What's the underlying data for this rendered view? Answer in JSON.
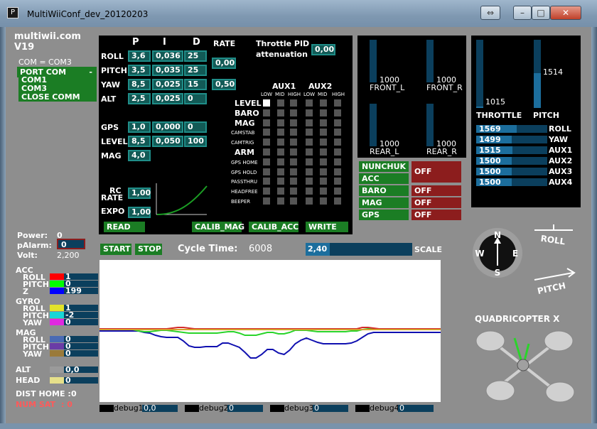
{
  "window": {
    "title": "MultiWiiConf_dev_20120203",
    "icon_text": "P"
  },
  "app": {
    "name": "multiwii.com",
    "version": "V19"
  },
  "com": {
    "current": "COM = COM3",
    "port_label": "PORT COM",
    "port_dash": "-",
    "ports": [
      "COM1",
      "COM3"
    ],
    "close_label": "CLOSE COMM"
  },
  "pid": {
    "headers": {
      "p": "P",
      "i": "I",
      "d": "D",
      "rate": "RATE"
    },
    "rows": [
      {
        "name": "ROLL",
        "p": "3,6",
        "i": "0,036",
        "d": "25"
      },
      {
        "name": "PITCH",
        "p": "3,5",
        "i": "0,035",
        "d": "25"
      },
      {
        "name": "YAW",
        "p": "8,5",
        "i": "0,025",
        "d": "15"
      },
      {
        "name": "ALT",
        "p": "2,5",
        "i": "0,025",
        "d": "0"
      },
      {
        "name": "GPS",
        "p": "1,0",
        "i": "0,000",
        "d": "0"
      },
      {
        "name": "LEVEL",
        "p": "8,5",
        "i": "0,050",
        "d": "100"
      },
      {
        "name": "MAG",
        "p": "4,0",
        "i": "",
        "d": ""
      }
    ],
    "rate_roll_pitch": "0,00",
    "rate_yaw": "0,50",
    "throttle_pid_label_1": "Throttle PID",
    "throttle_pid_label_2": "attenuation",
    "throttle_pid_value": "0,00",
    "rc_rate_label_1": "RC",
    "rc_rate_label_2": "RATE",
    "rc_rate_value": "1,00",
    "expo_label": "EXPO",
    "expo_value": "1,00"
  },
  "aux": {
    "aux1_label": "AUX1",
    "aux2_label": "AUX2",
    "subheads": [
      "LOW",
      "MID",
      "HIGH",
      "LOW",
      "MID",
      "HIGH"
    ],
    "boxes": [
      {
        "name": "LEVEL",
        "small": false,
        "on": [
          true,
          false,
          false,
          false,
          false,
          false
        ]
      },
      {
        "name": "BARO",
        "small": false,
        "on": [
          false,
          false,
          false,
          false,
          false,
          false
        ]
      },
      {
        "name": "MAG",
        "small": false,
        "on": [
          false,
          false,
          false,
          false,
          false,
          false
        ]
      },
      {
        "name": "CAMSTAB",
        "small": true,
        "on": [
          false,
          false,
          false,
          false,
          false,
          false
        ]
      },
      {
        "name": "CAMTRIG",
        "small": true,
        "on": [
          false,
          false,
          false,
          false,
          false,
          false
        ]
      },
      {
        "name": "ARM",
        "small": false,
        "on": [
          false,
          false,
          false,
          false,
          false,
          false
        ]
      },
      {
        "name": "GPS HOME",
        "small": true,
        "on": [
          false,
          false,
          false,
          false,
          false,
          false
        ]
      },
      {
        "name": "GPS HOLD",
        "small": true,
        "on": [
          false,
          false,
          false,
          false,
          false,
          false
        ]
      },
      {
        "name": "PASSTHRU",
        "small": true,
        "on": [
          false,
          false,
          false,
          false,
          false,
          false
        ]
      },
      {
        "name": "HEADFREE",
        "small": true,
        "on": [
          false,
          false,
          false,
          false,
          false,
          false
        ]
      },
      {
        "name": "BEEPER",
        "small": true,
        "on": [
          false,
          false,
          false,
          false,
          false,
          false
        ]
      }
    ]
  },
  "buttons": {
    "read": "READ",
    "calib_mag": "CALIB_MAG",
    "calib_acc": "CALIB_ACC",
    "write": "WRITE",
    "start": "START",
    "stop": "STOP"
  },
  "motors": [
    {
      "label": "FRONT_L",
      "value": "1000",
      "level": 0.0
    },
    {
      "label": "FRONT_R",
      "value": "1000",
      "level": 0.0
    },
    {
      "label": "REAR_L",
      "value": "1000",
      "level": 0.0
    },
    {
      "label": "REAR_R",
      "value": "1000",
      "level": 0.0
    }
  ],
  "sensors_status": [
    {
      "name": "NUNCHUK",
      "state": "OFF"
    },
    {
      "name": "ACC",
      "state": "OFF"
    },
    {
      "name": "BARO",
      "state": "OFF"
    },
    {
      "name": "MAG",
      "state": "OFF"
    },
    {
      "name": "GPS",
      "state": "OFF"
    }
  ],
  "rc": {
    "throttle": {
      "label": "THROTTLE",
      "value": "1015",
      "level": 0.02
    },
    "pitch": {
      "label": "PITCH",
      "value": "1514",
      "level": 0.51
    },
    "channels": [
      {
        "name": "ROLL",
        "value": "1569",
        "level": 0.57
      },
      {
        "name": "YAW",
        "value": "1499",
        "level": 0.5
      },
      {
        "name": "AUX1",
        "value": "1515",
        "level": 0.51
      },
      {
        "name": "AUX2",
        "value": "1500",
        "level": 0.5
      },
      {
        "name": "AUX3",
        "value": "1500",
        "level": 0.5
      },
      {
        "name": "AUX4",
        "value": "1500",
        "level": 0.5
      }
    ]
  },
  "status": {
    "power_label": "Power:",
    "power_value": "0",
    "palarm_label": "pAlarm:",
    "palarm_value": "0",
    "volt_label": "Volt:",
    "volt_value": "2,200",
    "cycle_label": "Cycle Time:",
    "cycle_value": "6008",
    "scale_value": "2,40",
    "scale_label": "SCALE",
    "dist_home_label": "DIST HOME :",
    "dist_home_value": "0",
    "num_sat_label": "NUM SAT",
    "num_sat_value": ":   0"
  },
  "sensor_values": {
    "acc": {
      "label": "ACC",
      "rows": [
        {
          "axis": "ROLL",
          "value": "1",
          "color": "#ff0000"
        },
        {
          "axis": "PITCH",
          "value": "0",
          "color": "#00ff00"
        },
        {
          "axis": "Z",
          "value": "199",
          "color": "#0000ff"
        }
      ]
    },
    "gyro": {
      "label": "GYRO",
      "rows": [
        {
          "axis": "ROLL",
          "value": "1",
          "color": "#e3e32a"
        },
        {
          "axis": "PITCH",
          "value": "-2",
          "color": "#18d6d6"
        },
        {
          "axis": "YAW",
          "value": "0",
          "color": "#e028e0"
        }
      ]
    },
    "mag": {
      "label": "MAG",
      "rows": [
        {
          "axis": "ROLL",
          "value": "0",
          "color": "#4a6ab4"
        },
        {
          "axis": "PITCH",
          "value": "0",
          "color": "#6a3ca6"
        },
        {
          "axis": "YAW",
          "value": "0",
          "color": "#9a7a3a"
        }
      ]
    },
    "alt": {
      "label": "ALT",
      "value": "0,0",
      "color": "#9a9a9a"
    },
    "head": {
      "label": "HEAD",
      "value": "0",
      "color": "#e6e08a"
    }
  },
  "debug": [
    {
      "label": "debug1",
      "value": "0,0"
    },
    {
      "label": "debug2",
      "value": "0"
    },
    {
      "label": "debug3",
      "value": "0"
    },
    {
      "label": "debug4",
      "value": "0"
    }
  ],
  "compass": {
    "n": "N",
    "e": "E",
    "s": "S",
    "w": "W"
  },
  "attitude": {
    "roll_label": "ROLL",
    "pitch_label": "PITCH"
  },
  "frame": {
    "label": "QUADRICOPTER X"
  },
  "colors": {
    "value_bg": "#125a56",
    "value_border": "#1f8d88",
    "button_green": "#1b7d24",
    "off_red": "#8c1d1d",
    "bar_fill": "#1c6e9d",
    "bar_bg": "#0b3f5d",
    "num_sat": "#ff5a5a"
  },
  "chart_data": {
    "type": "line",
    "title": "",
    "xlabel": "",
    "ylabel": "",
    "ylim": [
      -100,
      100
    ],
    "grid": false,
    "series": [
      {
        "color": "#1010b0",
        "values": [
          0,
          0,
          0,
          0,
          0,
          0,
          0,
          0,
          -2,
          -3,
          -6,
          -8,
          -9,
          -9,
          -9,
          -14,
          -21,
          -23,
          -23,
          -22,
          -22,
          -22,
          -17,
          -17,
          -20,
          -23,
          -30,
          -38,
          -38,
          -33,
          -26,
          -26,
          -31,
          -33,
          -27,
          -18,
          -13,
          -10,
          -13,
          -16,
          -18,
          -18,
          -18,
          -18,
          -18,
          -17,
          -14,
          -9,
          -4,
          -2,
          -2,
          -2,
          -2,
          -2,
          -2,
          -2,
          -2,
          -2,
          -2,
          -2,
          -2,
          -2
        ]
      },
      {
        "color": "#2ad42a",
        "values": [
          3,
          3,
          3,
          3,
          3,
          3,
          2,
          0,
          -1,
          -1,
          0,
          1,
          1,
          0,
          -1,
          -2,
          -3,
          -3,
          -3,
          -3,
          -3,
          -3,
          -2,
          -1,
          -1,
          -3,
          -6,
          -6,
          -6,
          -4,
          -2,
          -2,
          -4,
          -4,
          -2,
          1,
          1,
          1,
          0,
          -1,
          -1,
          -1,
          -1,
          -1,
          -1,
          0,
          0,
          2,
          3,
          3,
          3,
          3,
          3,
          3,
          3,
          3,
          3,
          3,
          3,
          3,
          3,
          3
        ]
      },
      {
        "color": "#d42a2a",
        "values": [
          3,
          3,
          3,
          3,
          3,
          3,
          3,
          3,
          3,
          3,
          3,
          3,
          3,
          4,
          5,
          5,
          4,
          3,
          3,
          3,
          3,
          3,
          3,
          3,
          3,
          3,
          3,
          3,
          3,
          3,
          3,
          3,
          3,
          3,
          3,
          3,
          3,
          3,
          3,
          3,
          3,
          3,
          3,
          3,
          3,
          3,
          3,
          5,
          5,
          4,
          3,
          3,
          3,
          3,
          3,
          3,
          3,
          3,
          3,
          3,
          3,
          3
        ]
      },
      {
        "color": "#d4a22a",
        "values": [
          2,
          2,
          2,
          2,
          2,
          2,
          2,
          2,
          2,
          2,
          2,
          2,
          2,
          2,
          2,
          2,
          2,
          2,
          2,
          2,
          2,
          2,
          2,
          2,
          2,
          2,
          2,
          2,
          2,
          2,
          2,
          2,
          2,
          2,
          2,
          2,
          2,
          2,
          2,
          2,
          2,
          2,
          2,
          2,
          2,
          2,
          2,
          2,
          2,
          2,
          2,
          2,
          2,
          2,
          2,
          2,
          2,
          2,
          2,
          2,
          2,
          2
        ]
      }
    ]
  }
}
